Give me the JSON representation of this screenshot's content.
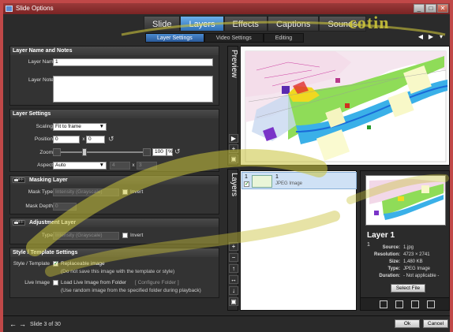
{
  "window": {
    "title": "Slide Options",
    "minimize": "_",
    "maximize": "□",
    "close": "✕"
  },
  "watermark": "cotin",
  "main_tabs": [
    {
      "label": "Slide",
      "active": false
    },
    {
      "label": "Layers",
      "active": true
    },
    {
      "label": "Effects",
      "active": false
    },
    {
      "label": "Captions",
      "active": false
    },
    {
      "label": "Sounds",
      "active": false
    }
  ],
  "sub_tabs": [
    {
      "label": "Layer Settings",
      "active": true
    },
    {
      "label": "Video Settings",
      "active": false
    },
    {
      "label": "Editing",
      "active": false
    }
  ],
  "nav": {
    "prev": "◀",
    "next": "▶",
    "menu": "▾"
  },
  "name_notes": {
    "header": "Layer Name and Notes",
    "name_label": "Layer Name",
    "name_value": "1",
    "notes_label": "Layer Notes",
    "notes_value": ""
  },
  "layer_settings": {
    "header": "Layer Settings",
    "scaling_label": "Scaling",
    "scaling_value": "Fit to frame",
    "position_label": "Position",
    "pos_x": "0",
    "pos_sep": "x",
    "pos_y": "0",
    "zoom_label": "Zoom",
    "zoom_value": "100",
    "zoom_unit": "%",
    "zoom_level": 0.28,
    "aspect_label": "Aspect",
    "aspect_value": "Auto",
    "aspect_w": "4",
    "aspect_sep": "x",
    "aspect_h": "3"
  },
  "masking": {
    "header": "Masking Layer",
    "toggle": "OFF",
    "mask_type_label": "Mask Type",
    "mask_type_value": "Intensity (Grayscale)",
    "invert_label": "Invert",
    "mask_depth_label": "Mask Depth",
    "mask_depth_value": "0"
  },
  "adjustment": {
    "header": "Adjustment Layer",
    "toggle": "OFF",
    "type_label": "Type",
    "type_value": "Intensity (Grayscale)",
    "invert_label": "Invert"
  },
  "style_template": {
    "header": "Style / Template Settings",
    "st_label": "Style / Template",
    "replaceable_label": "Replaceable image",
    "replaceable_note": "(Do not save this image with the template or style)",
    "replaceable_checked": true,
    "live_label": "Live Image",
    "live_check_label": "Load Live Image from Folder",
    "configure_label": "[ Configure Folder ]",
    "live_note": "(Use random image from the specified folder during playback)"
  },
  "preview_label": "Preview",
  "layers_label": "Layers",
  "layer_item": {
    "number": "1",
    "name": "1",
    "type": "JPEG Image"
  },
  "info": {
    "title": "Layer 1",
    "subtitle": "1",
    "rows": [
      {
        "k": "Source:",
        "v": "1.jpg"
      },
      {
        "k": "Resolution:",
        "v": "4723 × 2741"
      },
      {
        "k": "Size:",
        "v": "1,480 KB"
      },
      {
        "k": "Type:",
        "v": "JPEG Image"
      },
      {
        "k": "Duration:",
        "v": "- Not applicable -"
      }
    ],
    "select_file": "Select File"
  },
  "bottom": {
    "slide_text": "Slide 3 of 30",
    "ok": "Ok",
    "cancel": "Cancel"
  },
  "colors": {
    "titlebar": "#8a2e2e",
    "tab_active": "#3f86cc",
    "watermark": "#c9c23a",
    "border": "#c04848"
  }
}
